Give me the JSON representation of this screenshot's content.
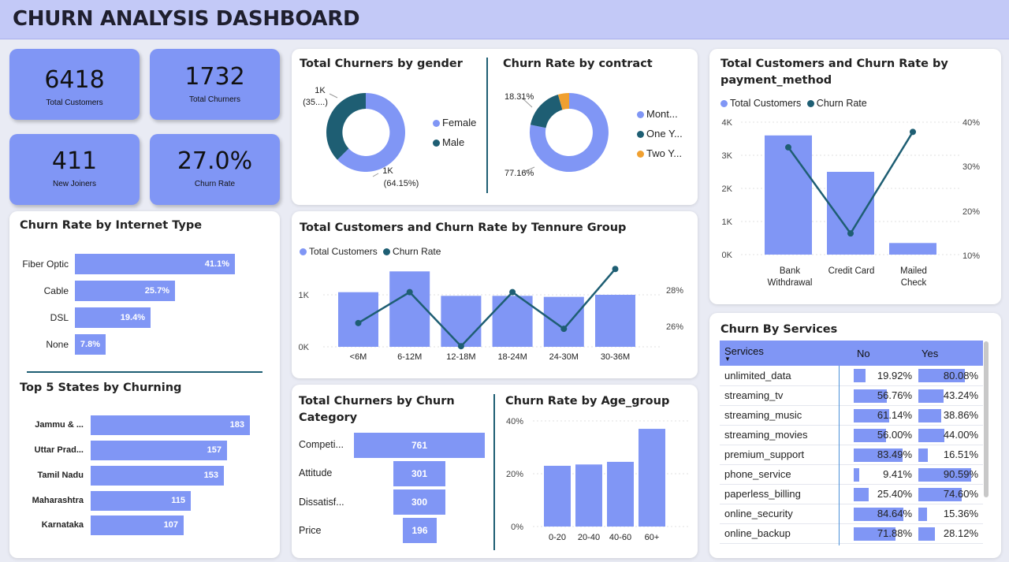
{
  "header": {
    "title": "CHURN ANALYSIS DASHBOARD"
  },
  "kpis": [
    {
      "value": "6418",
      "label": "Total Customers"
    },
    {
      "value": "1732",
      "label": "Total Churners"
    },
    {
      "value": "411",
      "label": "New Joiners"
    },
    {
      "value": "27.0%",
      "label": "Churn Rate"
    }
  ],
  "colors": {
    "primary": "#8096f5",
    "dark": "#1e5e73",
    "orange": "#f0a030",
    "header": "#c3c9f7"
  },
  "gender": {
    "title": "Total Churners by gender",
    "legend": [
      "Female",
      "Male"
    ],
    "labels": {
      "male_top": "1K",
      "male_bottom": "(35....)",
      "female_top": "1K",
      "female_bottom": "(64.15%)"
    }
  },
  "contract": {
    "title": "Churn Rate by contract",
    "legend": [
      "Mont...",
      "One Y...",
      "Two Y..."
    ],
    "labels": {
      "top": "18.31%",
      "bottom": "77.16%"
    }
  },
  "payment": {
    "title_line1": "Total Customers and Churn Rate by",
    "title_line2": "payment_method",
    "legend": [
      "Total Customers",
      "Churn Rate"
    ],
    "y_ticks": [
      "4K",
      "3K",
      "2K",
      "1K",
      "0K"
    ],
    "y2_ticks": [
      "40%",
      "30%",
      "20%",
      "10%"
    ],
    "categories": [
      [
        "Bank",
        "Withdrawal"
      ],
      [
        "Credit Card"
      ],
      [
        "Mailed",
        "Check"
      ]
    ]
  },
  "internet": {
    "title": "Churn Rate by Internet Type",
    "items": [
      {
        "label": "Fiber Optic",
        "value": "41.1%"
      },
      {
        "label": "Cable",
        "value": "25.7%"
      },
      {
        "label": "DSL",
        "value": "19.4%"
      },
      {
        "label": "None",
        "value": "7.8%"
      }
    ]
  },
  "states": {
    "title": "Top 5 States by Churning",
    "items": [
      {
        "label": "Jammu & ...",
        "value": "183"
      },
      {
        "label": "Uttar Prad...",
        "value": "157"
      },
      {
        "label": "Tamil Nadu",
        "value": "153"
      },
      {
        "label": "Maharashtra",
        "value": "115"
      },
      {
        "label": "Karnataka",
        "value": "107"
      }
    ]
  },
  "tenure": {
    "title": "Total Customers and Churn Rate by Tennure Group",
    "legend": [
      "Total Customers",
      "Churn Rate"
    ],
    "y_ticks": [
      "1K",
      "0K"
    ],
    "y2_ticks": [
      "28%",
      "26%"
    ],
    "categories": [
      "<6M",
      "6-12M",
      "12-18M",
      "18-24M",
      "24-30M",
      "30-36M"
    ]
  },
  "category": {
    "title_line1": "Total Churners by Churn",
    "title_line2": "Category",
    "items": [
      {
        "label": "Competi...",
        "value": "761"
      },
      {
        "label": "Attitude",
        "value": "301"
      },
      {
        "label": "Dissatisf...",
        "value": "300"
      },
      {
        "label": "Price",
        "value": "196"
      }
    ]
  },
  "age": {
    "title": "Churn Rate by Age_group",
    "y_ticks": [
      "40%",
      "20%",
      "0%"
    ],
    "categories": [
      "0-20",
      "20-40",
      "40-60",
      "60+"
    ]
  },
  "services": {
    "title": "Churn By Services",
    "headers": [
      "Services",
      "No",
      "Yes"
    ],
    "rows": [
      {
        "name": "unlimited_data",
        "no": "19.92%",
        "yes": "80.08%"
      },
      {
        "name": "streaming_tv",
        "no": "56.76%",
        "yes": "43.24%"
      },
      {
        "name": "streaming_music",
        "no": "61.14%",
        "yes": "38.86%"
      },
      {
        "name": "streaming_movies",
        "no": "56.00%",
        "yes": "44.00%"
      },
      {
        "name": "premium_support",
        "no": "83.49%",
        "yes": "16.51%"
      },
      {
        "name": "phone_service",
        "no": "9.41%",
        "yes": "90.59%"
      },
      {
        "name": "paperless_billing",
        "no": "25.40%",
        "yes": "74.60%"
      },
      {
        "name": "online_security",
        "no": "84.64%",
        "yes": "15.36%"
      },
      {
        "name": "online_backup",
        "no": "71.88%",
        "yes": "28.12%"
      }
    ]
  },
  "chart_data": [
    {
      "type": "pie",
      "title": "Total Churners by gender",
      "categories": [
        "Female",
        "Male"
      ],
      "values": [
        64.15,
        35.85
      ]
    },
    {
      "type": "pie",
      "title": "Churn Rate by contract",
      "categories": [
        "Mont...",
        "One Y...",
        "Two Y..."
      ],
      "values": [
        77.16,
        18.31,
        4.53
      ]
    },
    {
      "type": "bar",
      "title": "Total Customers and Churn Rate by payment_method",
      "categories": [
        "Bank Withdrawal",
        "Credit Card",
        "Mailed Check"
      ],
      "series": [
        {
          "name": "Total Customers",
          "values": [
            3600,
            2500,
            350
          ]
        },
        {
          "name": "Churn Rate",
          "values": [
            34.3,
            14.8,
            37.8
          ]
        }
      ],
      "ylim": [
        0,
        4000
      ],
      "y2lim": [
        10,
        40
      ]
    },
    {
      "type": "bar",
      "title": "Churn Rate by Internet Type",
      "categories": [
        "Fiber Optic",
        "Cable",
        "DSL",
        "None"
      ],
      "values": [
        41.1,
        25.7,
        19.4,
        7.8
      ]
    },
    {
      "type": "bar",
      "title": "Top 5 States by Churning",
      "categories": [
        "Jammu & ...",
        "Uttar Prad...",
        "Tamil Nadu",
        "Maharashtra",
        "Karnataka"
      ],
      "values": [
        183,
        157,
        153,
        115,
        107
      ]
    },
    {
      "type": "bar",
      "title": "Total Customers and Churn Rate by Tennure Group",
      "categories": [
        "<6M",
        "6-12M",
        "12-18M",
        "18-24M",
        "24-30M",
        "30-36M"
      ],
      "series": [
        {
          "name": "Total Customers",
          "values": [
            1050,
            1450,
            980,
            980,
            960,
            1000
          ]
        },
        {
          "name": "Churn Rate",
          "values": [
            26.2,
            27.8,
            25.0,
            27.8,
            25.9,
            29.0
          ]
        }
      ],
      "ylim": [
        0,
        1600
      ],
      "y2lim": [
        24.6,
        29.5
      ]
    },
    {
      "type": "bar",
      "title": "Total Churners by Churn Category",
      "categories": [
        "Competi...",
        "Attitude",
        "Dissatisf...",
        "Price"
      ],
      "values": [
        761,
        301,
        300,
        196
      ]
    },
    {
      "type": "bar",
      "title": "Churn Rate by Age_group",
      "categories": [
        "0-20",
        "20-40",
        "40-60",
        "60+"
      ],
      "values": [
        23,
        23.5,
        24.5,
        37
      ],
      "ylim": [
        0,
        40
      ]
    },
    {
      "type": "table",
      "title": "Churn By Services",
      "columns": [
        "Services",
        "No",
        "Yes"
      ],
      "rows": [
        [
          "unlimited_data",
          19.92,
          80.08
        ],
        [
          "streaming_tv",
          56.76,
          43.24
        ],
        [
          "streaming_music",
          61.14,
          38.86
        ],
        [
          "streaming_movies",
          56.0,
          44.0
        ],
        [
          "premium_support",
          83.49,
          16.51
        ],
        [
          "phone_service",
          9.41,
          90.59
        ],
        [
          "paperless_billing",
          25.4,
          74.6
        ],
        [
          "online_security",
          84.64,
          15.36
        ],
        [
          "online_backup",
          71.88,
          28.12
        ]
      ]
    }
  ]
}
